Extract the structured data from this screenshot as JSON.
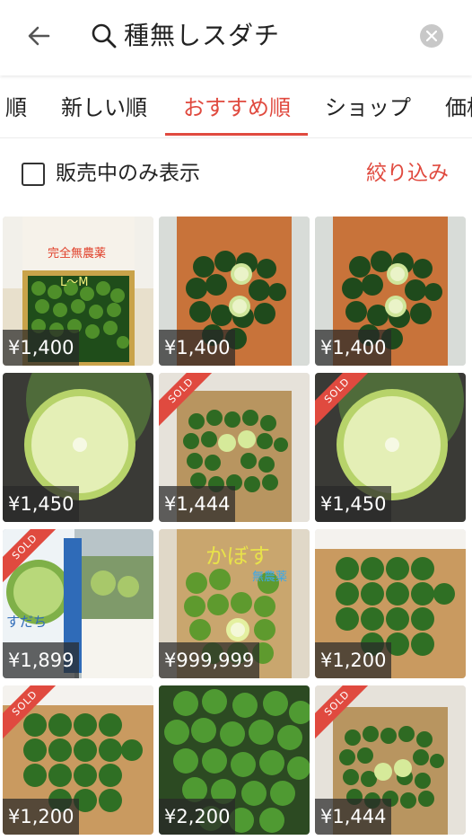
{
  "header": {
    "query": "種無しスダチ"
  },
  "tabs": [
    {
      "label": "順"
    },
    {
      "label": "新しい順"
    },
    {
      "label": "おすすめ順"
    },
    {
      "label": "ショップ"
    },
    {
      "label": "価格"
    }
  ],
  "filter": {
    "checkbox_label": "販売中のみ表示",
    "refine_label": "絞り込み"
  },
  "colors": {
    "accent": "#e04a3f"
  },
  "items": [
    {
      "price": "¥1,400",
      "sold": false,
      "overlay": [
        "完全無農薬",
        "L〜M"
      ]
    },
    {
      "price": "¥1,400",
      "sold": false
    },
    {
      "price": "¥1,400",
      "sold": false
    },
    {
      "price": "¥1,450",
      "sold": false
    },
    {
      "price": "¥1,444",
      "sold": true
    },
    {
      "price": "¥1,450",
      "sold": true
    },
    {
      "price": "¥1,899",
      "sold": true,
      "overlay": [
        "すだち"
      ]
    },
    {
      "price": "¥999,999",
      "sold": false,
      "overlay": [
        "かぼす",
        "無農薬"
      ]
    },
    {
      "price": "¥1,200",
      "sold": false
    },
    {
      "price": "¥1,200",
      "sold": true
    },
    {
      "price": "¥2,200",
      "sold": false
    },
    {
      "price": "¥1,444",
      "sold": true
    }
  ],
  "sold_label": "SOLD"
}
